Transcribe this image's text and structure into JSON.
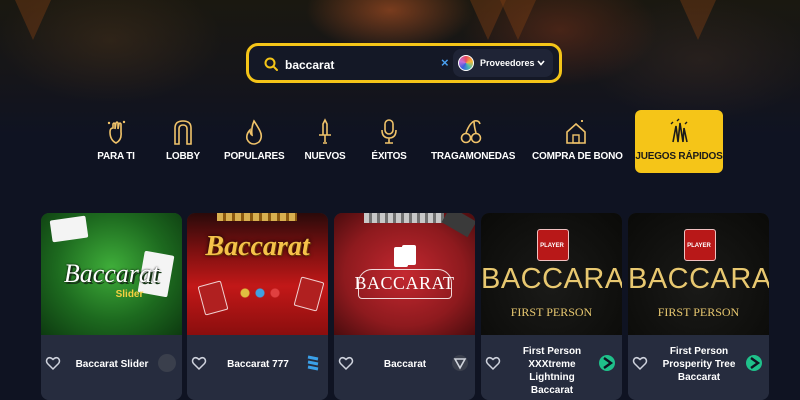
{
  "search": {
    "value": "baccarat",
    "clear_symbol": "×",
    "providers_label": "Proveedores",
    "chevron": "⌄"
  },
  "categories": [
    {
      "label": "PARA TI",
      "icon": "sparkle-hand-icon"
    },
    {
      "label": "LOBBY",
      "icon": "arch-icon"
    },
    {
      "label": "POPULARES",
      "icon": "flame-icon"
    },
    {
      "label": "NUEVOS",
      "icon": "sword-icon"
    },
    {
      "label": "ÉXITOS",
      "icon": "microphone-icon"
    },
    {
      "label": "TRAGAMONEDAS",
      "icon": "cherries-icon"
    },
    {
      "label": "COMPRA DE BONO",
      "icon": "house-bonus-icon"
    },
    {
      "label": "JUEGOS RÁPIDOS",
      "icon": "rockets-icon",
      "active": true
    }
  ],
  "games": [
    {
      "title": "Baccarat Slider",
      "thumb_text": "Baccarat",
      "thumb_sub": "Slider",
      "provider_icon": "provider-gray-icon"
    },
    {
      "title": "Baccarat 777",
      "thumb_text": "Baccarat",
      "provider_icon": "provider-blue-stripes-icon"
    },
    {
      "title": "Baccarat",
      "thumb_text": "BACCARAT",
      "provider_icon": "provider-triangle-icon"
    },
    {
      "title_lines": [
        "First Person",
        "XXXtreme Lightning",
        "Baccarat"
      ],
      "thumb_text": "BACCARAT",
      "thumb_sub": "FIRST PERSON",
      "thumb_badge": "PLAYER",
      "provider_icon": "provider-evolution-icon"
    },
    {
      "title_lines": [
        "First Person",
        "Prosperity Tree",
        "Baccarat"
      ],
      "thumb_text": "BACCARAT",
      "thumb_sub": "FIRST PERSON",
      "thumb_badge": "PLAYER",
      "provider_icon": "provider-evolution-icon"
    }
  ],
  "colors": {
    "accent": "#f5c518",
    "background": "#0f1322",
    "card": "#272d3f",
    "clear": "#4aa0f0"
  }
}
